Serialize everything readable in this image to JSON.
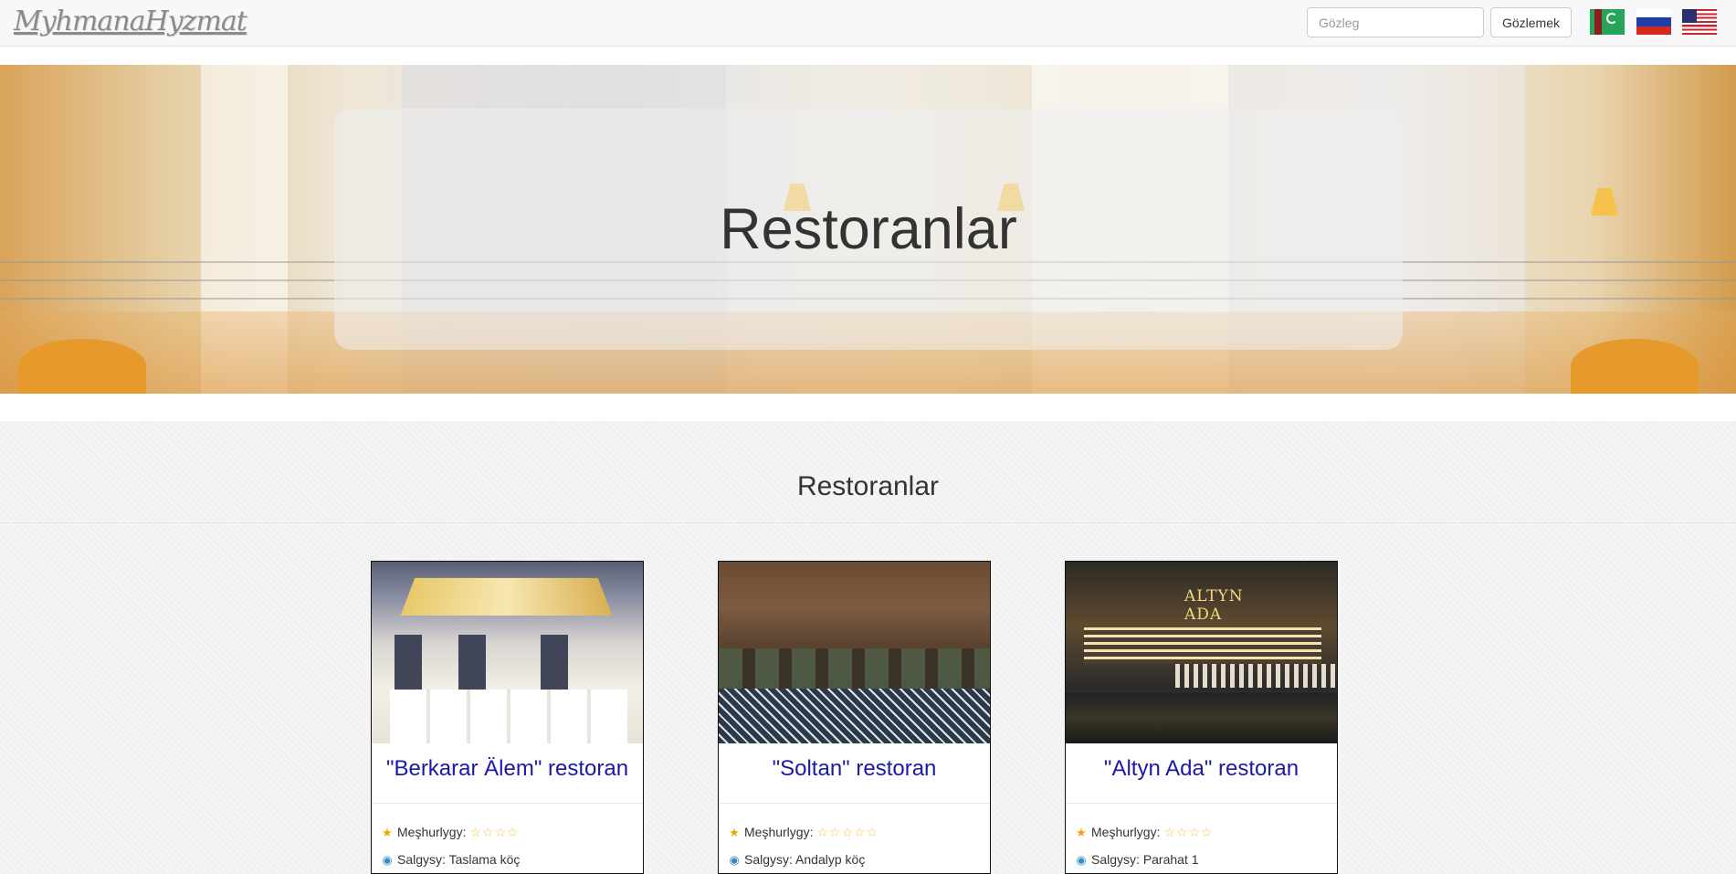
{
  "navbar": {
    "brand": "MyhmanaHyzmat",
    "search_placeholder": "Gözleg",
    "search_button": "Gözlemek",
    "languages": [
      "turkmen-flag",
      "russian-flag",
      "usa-flag"
    ]
  },
  "hero": {
    "title": "Restoranlar"
  },
  "section": {
    "title": "Restoranlar"
  },
  "cards": [
    {
      "title": "\"Berkarar Älem\" restoran",
      "rating_label": "Meşhurlygy:",
      "rating": 4,
      "rating_stars": "☆☆☆☆",
      "address_label": "Salgysy:",
      "address": "Taslama köç"
    },
    {
      "title": "\"Soltan\" restoran",
      "rating_label": "Meşhurlygy:",
      "rating": 5,
      "rating_stars": "☆☆☆☆☆",
      "address_label": "Salgysy:",
      "address": "Andalyp köç"
    },
    {
      "title": "\"Altyn Ada\" restoran",
      "rating_label": "Meşhurlygy:",
      "rating": 4,
      "rating_stars": "☆☆☆☆",
      "address_label": "Salgysy:",
      "address": "Parahat 1"
    }
  ],
  "image3_sign": "ALTYN ADA",
  "colors": {
    "card_title": "#1a1aa6",
    "star": "#f5c542",
    "navbar_bg": "#f8f8f8"
  }
}
